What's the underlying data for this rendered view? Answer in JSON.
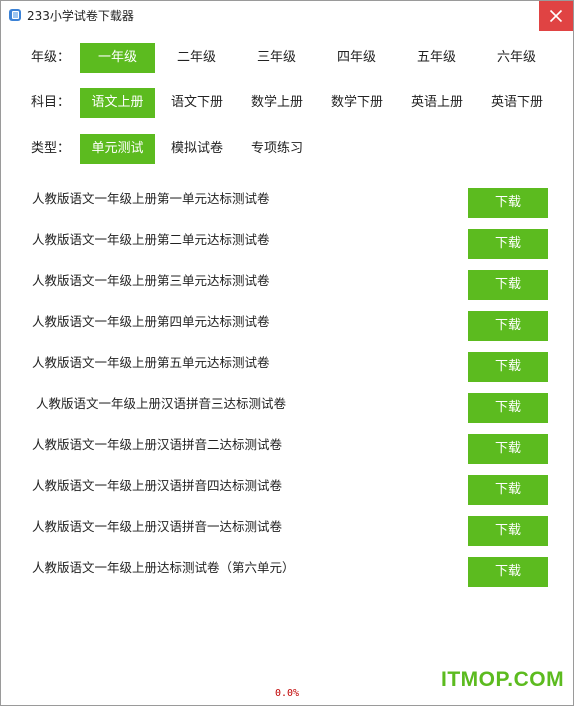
{
  "window": {
    "title": "233小学试卷下载器"
  },
  "filters": {
    "grade": {
      "label": "年级：",
      "options": [
        "一年级",
        "二年级",
        "三年级",
        "四年级",
        "五年级",
        "六年级"
      ],
      "selected": "一年级"
    },
    "subject": {
      "label": "科目：",
      "options": [
        "语文上册",
        "语文下册",
        "数学上册",
        "数学下册",
        "英语上册",
        "英语下册"
      ],
      "selected": "语文上册"
    },
    "type": {
      "label": "类型：",
      "options": [
        "单元测试",
        "模拟试卷",
        "专项练习"
      ],
      "selected": "单元测试"
    }
  },
  "papers": [
    {
      "title": "人教版语文一年级上册第一单元达标测试卷",
      "action": "下载"
    },
    {
      "title": "人教版语文一年级上册第二单元达标测试卷",
      "action": "下载"
    },
    {
      "title": "人教版语文一年级上册第三单元达标测试卷",
      "action": "下载"
    },
    {
      "title": "人教版语文一年级上册第四单元达标测试卷",
      "action": "下载"
    },
    {
      "title": "人教版语文一年级上册第五单元达标测试卷",
      "action": "下载"
    },
    {
      "title": " 人教版语文一年级上册汉语拼音三达标测试卷",
      "action": "下载"
    },
    {
      "title": "人教版语文一年级上册汉语拼音二达标测试卷",
      "action": "下载"
    },
    {
      "title": "人教版语文一年级上册汉语拼音四达标测试卷",
      "action": "下载"
    },
    {
      "title": "人教版语文一年级上册汉语拼音一达标测试卷",
      "action": "下载"
    },
    {
      "title": "人教版语文一年级上册达标测试卷（第六单元）",
      "action": "下载"
    }
  ],
  "status": {
    "progress_text": "0.0%",
    "progress": 0.0
  },
  "watermark": {
    "text": "ITMOP.COM"
  },
  "colors": {
    "accent": "#5cbb1f",
    "close": "#e04343",
    "progress_text": "#c00000",
    "app_icon": "#3b82d6"
  },
  "icons": {
    "app": "app-icon",
    "close": "close-icon"
  }
}
